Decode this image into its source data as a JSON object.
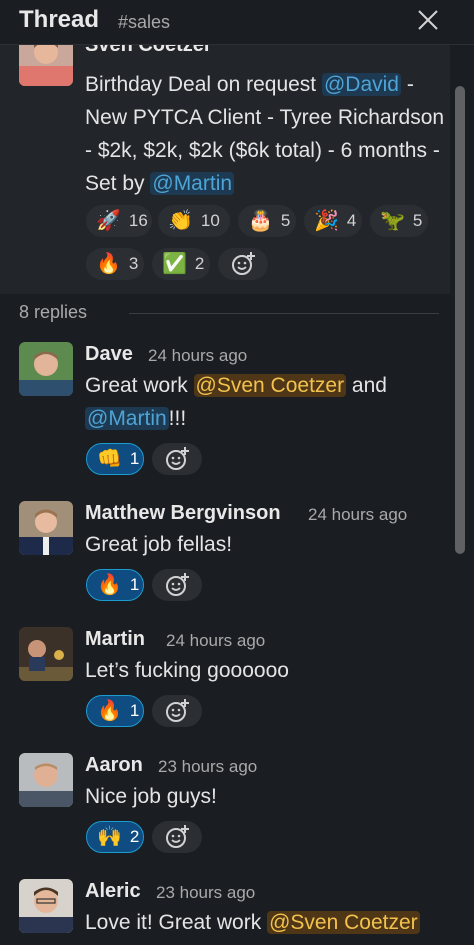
{
  "header": {
    "title": "Thread",
    "channel": "#sales"
  },
  "parent": {
    "author": "Sven Coetzer",
    "text_1": "Birthday Deal on request ",
    "mention_1": "@David",
    "text_2": " - New PYTCA Client - Tyree Richardson - $2k, $2k, $2k ($6k total) - 6 months - Set by ",
    "mention_2": "@Martin",
    "reactions": [
      {
        "emoji": "🚀",
        "count": "16"
      },
      {
        "emoji": "👏",
        "count": "10"
      },
      {
        "emoji": "🎂",
        "count": "5"
      },
      {
        "emoji": "🎉",
        "count": "4"
      },
      {
        "emoji": "🦖",
        "count": "5"
      },
      {
        "emoji": "🔥",
        "count": "3"
      },
      {
        "emoji": "✅",
        "count": "2"
      }
    ]
  },
  "replies_label": "8 replies",
  "replies": [
    {
      "author": "Dave",
      "time": "24 hours ago",
      "text_1": "Great work ",
      "mention_1": "@Sven Coetzer",
      "text_2": " and ",
      "mention_2": "@Martin",
      "text_3": "!!!",
      "reaction": {
        "emoji": "👊",
        "count": "1"
      }
    },
    {
      "author": "Matthew Bergvinson",
      "time": "24 hours ago",
      "text": "Great job fellas!",
      "reaction": {
        "emoji": "🔥",
        "count": "1"
      }
    },
    {
      "author": "Martin",
      "time": "24 hours ago",
      "text": "Let’s fucking goooooo",
      "reaction": {
        "emoji": "🔥",
        "count": "1"
      }
    },
    {
      "author": "Aaron",
      "time": "23 hours ago",
      "text": "Nice job guys!",
      "reaction": {
        "emoji": "🙌",
        "count": "2"
      }
    },
    {
      "author": "Aleric",
      "time": "23 hours ago",
      "text_1": "Love it! Great work ",
      "mention_1": "@Sven Coetzer"
    }
  ],
  "colors": {
    "background": "#1a1d21",
    "parent_background": "#222529",
    "mention": "#4ea4d6",
    "self_mention": "#f2c24d",
    "active_reaction": "#0f4c81"
  }
}
